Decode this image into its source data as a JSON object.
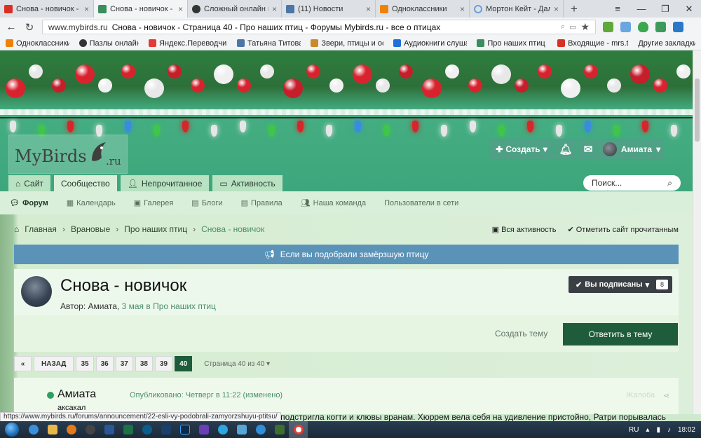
{
  "browser": {
    "tabs": [
      {
        "title": "Снова - новичок - mrs.t",
        "favicon_color": "#d93025",
        "active": false
      },
      {
        "title": "Снова - новичок - Сно",
        "favicon_color": "#3a8d5c",
        "active": true
      },
      {
        "title": "Сложный онлайн пазл (",
        "favicon_color": "#333333",
        "active": false
      },
      {
        "title": "(11) Новости",
        "favicon_color": "#4a76a8",
        "active": false
      },
      {
        "title": "Одноклассники",
        "favicon_color": "#ee8208",
        "active": false
      },
      {
        "title": "Мортон Кейт - Далеки",
        "favicon_color": "#6a9fd8",
        "active": false
      }
    ],
    "address": {
      "host": "www.mybirds.ru",
      "page_title": "Снова - новичок - Страница 40 - Про наших птиц - Форумы Mybirds.ru - все о птицах"
    },
    "bookmarks": [
      {
        "label": "Одноклассники",
        "color": "#ee8208"
      },
      {
        "label": "Пазлы онлайн",
        "color": "#333333"
      },
      {
        "label": "Яндекс.Переводчик",
        "color": "#e53935"
      },
      {
        "label": "Татьяна Титова",
        "color": "#4a76a8"
      },
      {
        "label": "Звери, птицы и ос",
        "color": "#c98a2b"
      },
      {
        "label": "Аудиокниги слуша",
        "color": "#1e6fd9"
      },
      {
        "label": "Про наших птиц -",
        "color": "#3a8d5c"
      },
      {
        "label": "Входящие - mrs.t.",
        "color": "#d93025"
      }
    ],
    "other_bookmarks": "Другие закладки"
  },
  "site": {
    "logo_word": "MyBirds",
    "logo_tld": ".ru",
    "userbar": {
      "create_label": "Создать",
      "username": "Амиата"
    },
    "nav_tabs": [
      {
        "label": "Сайт",
        "icon": "home-icon",
        "active": false
      },
      {
        "label": "Сообщество",
        "icon": "",
        "active": true
      },
      {
        "label": "Непрочитанное",
        "icon": "user-icon",
        "active": false
      },
      {
        "label": "Активность",
        "icon": "activity-icon",
        "active": false
      }
    ],
    "search_placeholder": "Поиск...",
    "subnav": [
      {
        "label": "Форум",
        "icon": "comment-icon",
        "active": true
      },
      {
        "label": "Календарь",
        "icon": "calendar-icon",
        "active": false
      },
      {
        "label": "Галерея",
        "icon": "image-icon",
        "active": false
      },
      {
        "label": "Блоги",
        "icon": "doc-icon",
        "active": false
      },
      {
        "label": "Правила",
        "icon": "doc-icon",
        "active": false
      },
      {
        "label": "Наша команда",
        "icon": "team-icon",
        "active": false
      },
      {
        "label": "Пользователи в сети",
        "icon": "",
        "active": false
      }
    ],
    "breadcrumbs": [
      "Главная",
      "Врановые",
      "Про наших птиц",
      "Снова - новичок"
    ],
    "all_activity": "Вся активность",
    "mark_read": "Отметить сайт прочитанным",
    "notice": "Если вы подобрали замёрзшую птицу"
  },
  "thread": {
    "title": "Снова - новичок",
    "author_prefix": "Автор:",
    "author": "Амиата,",
    "date_forum": "3 мая в Про наших птиц",
    "watch_label": "Вы подписаны",
    "watch_count": "8",
    "create_topic": "Создать тему",
    "reply": "Ответить в тему"
  },
  "pagination": {
    "prev_icon": "«",
    "back_label": "НАЗАД",
    "pages": [
      "35",
      "36",
      "37",
      "38",
      "39",
      "40"
    ],
    "current": "40",
    "page_of": "Страница 40 из 40"
  },
  "post": {
    "author": "Амиата",
    "rank": "аксакал",
    "posted": "Опубликовано: Четверг в 11:22 (изменено)",
    "report": "Жалоба",
    "body_fragment": "хом и подстригла когти и клювы вранам. Хюррем вела себя на удивление пристойно, Ратри порывалась"
  },
  "status_url": "https://www.mybirds.ru/forums/announcement/22-esli-vy-podobrali-zamyorzshuyu-ptitsu/",
  "taskbar": {
    "lang": "RU",
    "time": "18:02"
  }
}
